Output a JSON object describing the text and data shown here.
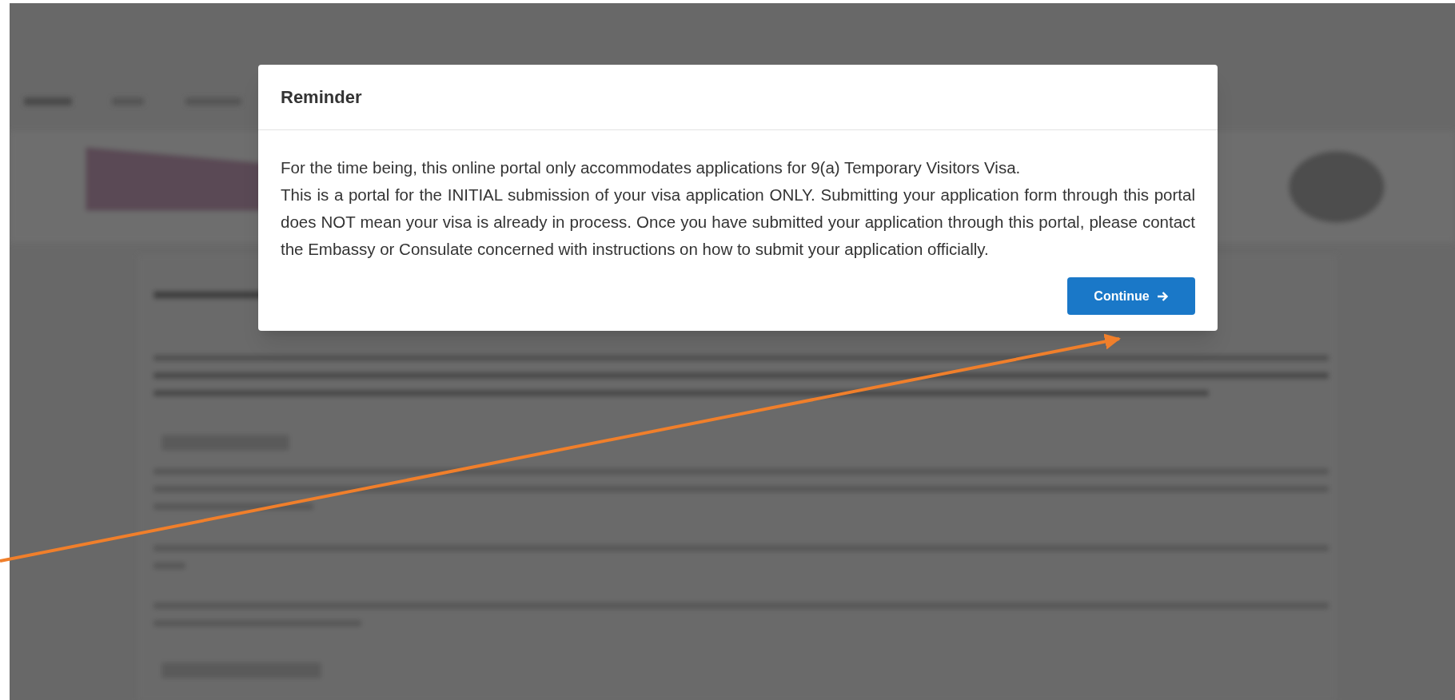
{
  "dialog": {
    "title": "Reminder",
    "paragraphs": [
      "For the time being, this online portal only accommodates applications for 9(a) Temporary Visitors Visa.",
      "This is a portal for the INITIAL submission of your visa application ONLY. Submitting your application form through this portal does NOT mean your visa is already in process. Once you have submitted your application through this portal, please contact the Embassy or Consulate concerned with instructions on how to submit your application officially."
    ],
    "button": {
      "label": "Continue"
    }
  }
}
